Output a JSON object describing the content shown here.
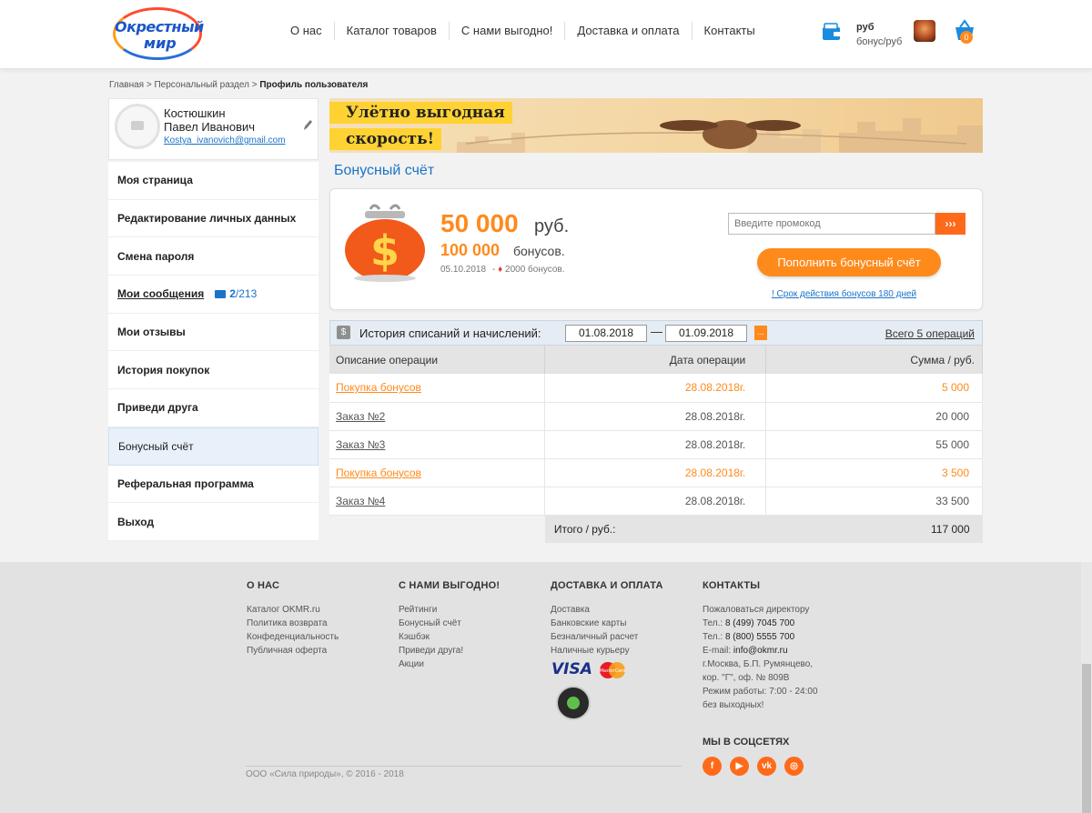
{
  "header": {
    "logo_line1": "Окрестный",
    "logo_line2": "мир",
    "nav": [
      "О нас",
      "Каталог товаров",
      "С нами выгодно!",
      "Доставка и оплата",
      "Контакты"
    ],
    "balance_rub": "руб",
    "balance_bonus": "бонус/руб",
    "cart_count": "0"
  },
  "breadcrumb": {
    "path": "Главная > Персональный раздел > ",
    "current": "Профиль пользователя"
  },
  "profile": {
    "last_name": "Костюшкин",
    "first_name": "Павел Иванович",
    "email": "Kostya_ivanovich@gmail.com"
  },
  "sidebar": {
    "items": [
      "Моя страница",
      "Редактирование личных данных",
      "Смена пароля",
      "Мои сообщения",
      "Мои отзывы",
      "История покупок",
      "Приведи друга",
      "Бонусный счёт",
      "Реферальная программа",
      "Выход"
    ],
    "messages_unread": "2",
    "messages_total": "/213"
  },
  "banner": {
    "line1": "Улётно выгодная",
    "line2": "скорость!"
  },
  "bonus": {
    "title": "Бонусный счёт",
    "rub_amount": "50 000",
    "rub_unit": "руб.",
    "bonus_amount": "100 000",
    "bonus_unit": "бонусов.",
    "date": "05.10.2018",
    "extra_prefix": "-",
    "extra": "2000 бонусов.",
    "promo_placeholder": "Введите промокод",
    "promo_button": "›››",
    "topup_button": "Пополнить бонусный счёт",
    "expire_note": "! Срок действия бонусов 180 дней"
  },
  "history": {
    "title": "История списаний и начислений:",
    "date_from": "01.08.2018",
    "dash": "—",
    "date_to": "01.09.2018",
    "date_button": "...",
    "total_ops": "Всего 5 операций",
    "columns": [
      "Описание операции",
      "Дата операции",
      "Сумма / руб."
    ],
    "rows": [
      {
        "desc": "Покупка бонусов",
        "date": "28.08.2018г.",
        "sum": "5 000"
      },
      {
        "desc": "Заказ №2",
        "date": "28.08.2018г.",
        "sum": "20 000"
      },
      {
        "desc": "Заказ №3",
        "date": "28.08.2018г.",
        "sum": "55 000"
      },
      {
        "desc": "Покупка бонусов",
        "date": "28.08.2018г.",
        "sum": "3 500"
      },
      {
        "desc": "Заказ №4",
        "date": "28.08.2018г.",
        "sum": "33 500"
      }
    ],
    "total_label": "Итого / руб.:",
    "total_value": "117 000"
  },
  "footer": {
    "col1": {
      "title": "О НАС",
      "links": [
        "Каталог OKMR.ru",
        "Политика возврата",
        "Конфеденциальность",
        "Публичная оферта"
      ]
    },
    "col2": {
      "title": "С НАМИ ВЫГОДНО!",
      "links": [
        "Рейтинги",
        "Бонусный счёт",
        "Кэшбэк",
        "Приведи друга!",
        "Акции"
      ]
    },
    "col3": {
      "title": "ДОСТАВКА И ОПЛАТА",
      "links": [
        "Доставка",
        "Банковские карты",
        "Безналичный расчет",
        "Наличные курьеру"
      ]
    },
    "col4": {
      "title": "КОНТАКТЫ",
      "complain": "Пожаловаться директору",
      "tel1_label": "Тел.:",
      "tel1": "8 (499) 7045 700",
      "tel2_label": "Тел.:",
      "tel2": "8 (800) 5555 700",
      "email_label": "E-mail:",
      "email": "info@okmr.ru",
      "address1": "г.Москва, Б.П. Румянцево,",
      "address2": "кор. \"Г\", оф. № 809В",
      "hours1": "Режим работы: 7:00 - 24:00",
      "hours2": "без выходных!"
    },
    "visa": "VISA",
    "mastercard": "MasterCard",
    "social_title": "МЫ В СОЦСЕТЯХ",
    "socials": [
      "f",
      "▶",
      "vk",
      "◎"
    ],
    "copyright": "ООО «Сила природы», © 2016 - 2018"
  },
  "colors": {
    "accent": "#ff8a1c",
    "link": "#1a73c8"
  }
}
